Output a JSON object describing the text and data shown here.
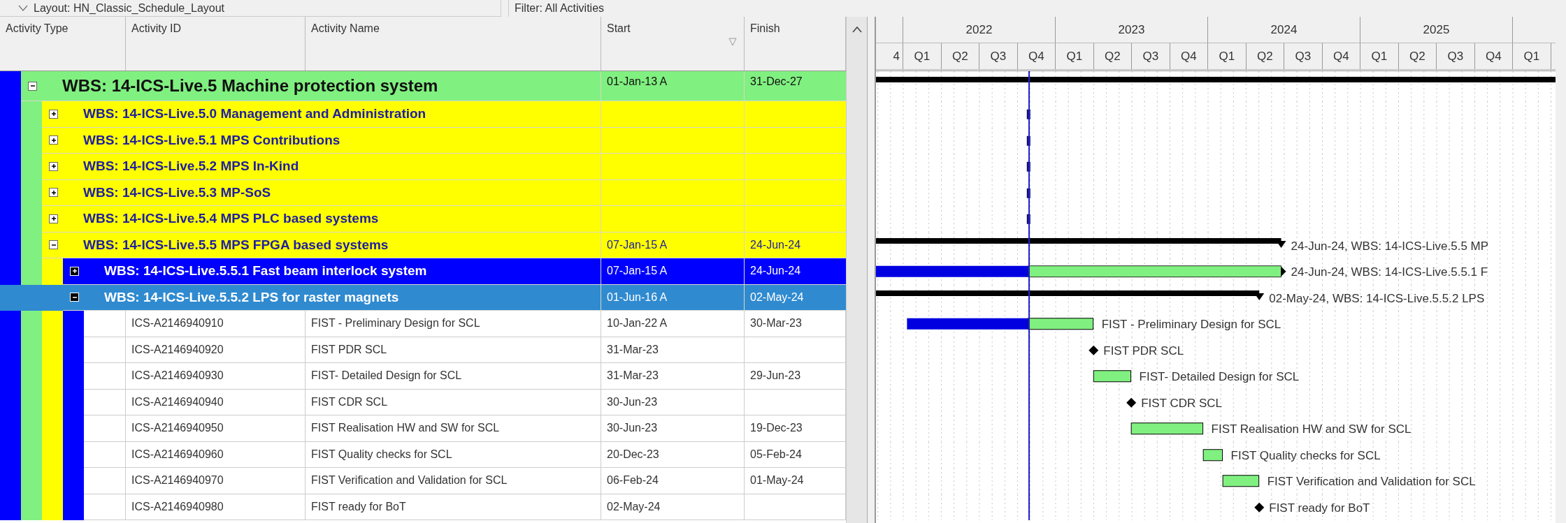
{
  "toolbar": {
    "layout": "Layout: HN_Classic_Schedule_Layout",
    "filter": "Filter: All Activities"
  },
  "columns": [
    {
      "label": "Activity Type",
      "sorted": false
    },
    {
      "label": "Activity ID",
      "sorted": false
    },
    {
      "label": "Activity Name",
      "sorted": false
    },
    {
      "label": "Start",
      "sorted": true
    },
    {
      "label": "Finish",
      "sorted": false
    }
  ],
  "gantt": {
    "years": [
      "2022",
      "2023",
      "2024",
      "2025"
    ],
    "quarters": [
      "4",
      "Q1",
      "Q2",
      "Q3",
      "Q4",
      "Q1",
      "Q2",
      "Q3",
      "Q4",
      "Q1",
      "Q2",
      "Q3",
      "Q4",
      "Q1",
      "Q2",
      "Q3",
      "Q4",
      "Q1"
    ]
  },
  "rows": [
    {
      "kind": "wbs",
      "title": "WBS: 14-ICS-Live.5  Machine protection system",
      "start": "01-Jan-13 A",
      "finish": "31-Dec-27",
      "expanded": true,
      "selected": false,
      "children": [
        {
          "kind": "wbs",
          "title": "WBS: 14-ICS-Live.5.0  Management and Administration",
          "expanded": false,
          "selected": false
        },
        {
          "kind": "wbs",
          "title": "WBS: 14-ICS-Live.5.1  MPS Contributions",
          "expanded": false,
          "selected": false
        },
        {
          "kind": "wbs",
          "title": "WBS: 14-ICS-Live.5.2  MPS In-Kind",
          "expanded": false,
          "selected": false
        },
        {
          "kind": "wbs",
          "title": "WBS: 14-ICS-Live.5.3  MP-SoS",
          "expanded": false,
          "selected": false
        },
        {
          "kind": "wbs",
          "title": "WBS: 14-ICS-Live.5.4  MPS PLC based systems",
          "expanded": false,
          "selected": false
        },
        {
          "kind": "wbs",
          "title": "WBS: 14-ICS-Live.5.5  MPS FPGA based systems",
          "start": "07-Jan-15 A",
          "finish": "24-Jun-24",
          "expanded": true,
          "selected": false,
          "bar_label": "24-Jun-24, WBS: 14-ICS-Live.5.5  MP",
          "children": [
            {
              "kind": "wbs",
              "title": "WBS: 14-ICS-Live.5.5.1  Fast beam interlock system",
              "start": "07-Jan-15 A",
              "finish": "24-Jun-24",
              "expanded": false,
              "selected": false,
              "bar_label": "24-Jun-24, WBS: 14-ICS-Live.5.5.1  F"
            },
            {
              "kind": "wbs",
              "title": "WBS: 14-ICS-Live.5.5.2  LPS for raster magnets",
              "start": "01-Jun-16 A",
              "finish": "02-May-24",
              "expanded": true,
              "selected": true,
              "bar_label": "02-May-24, WBS: 14-ICS-Live.5.5.2  LPS",
              "children": [
                {
                  "kind": "task",
                  "id": "ICS-A2146940910",
                  "name": "FIST - Preliminary Design for SCL",
                  "start": "10-Jan-22 A",
                  "finish": "30-Mar-23",
                  "selected": false,
                  "bar_label": "FIST - Preliminary Design for SCL"
                },
                {
                  "kind": "milestone",
                  "id": "ICS-A2146940920",
                  "name": "FIST PDR SCL",
                  "start": "31-Mar-23",
                  "selected": false,
                  "bar_label": "FIST PDR SCL"
                },
                {
                  "kind": "task",
                  "id": "ICS-A2146940930",
                  "name": "FIST- Detailed  Design for SCL",
                  "start": "31-Mar-23",
                  "finish": "29-Jun-23",
                  "selected": false,
                  "bar_label": "FIST- Detailed  Design for SCL"
                },
                {
                  "kind": "milestone",
                  "id": "ICS-A2146940940",
                  "name": "FIST CDR SCL",
                  "start": "30-Jun-23",
                  "selected": false,
                  "bar_label": "FIST CDR SCL"
                },
                {
                  "kind": "task",
                  "id": "ICS-A2146940950",
                  "name": "FIST Realisation HW and SW for SCL",
                  "start": "30-Jun-23",
                  "finish": "19-Dec-23",
                  "selected": false,
                  "bar_label": "FIST Realisation HW and SW for SCL"
                },
                {
                  "kind": "task",
                  "id": "ICS-A2146940960",
                  "name": "FIST Quality checks for SCL",
                  "start": "20-Dec-23",
                  "finish": "05-Feb-24",
                  "selected": false,
                  "bar_label": "FIST Quality checks for SCL"
                },
                {
                  "kind": "task",
                  "id": "ICS-A2146940970",
                  "name": "FIST Verification and Validation for SCL",
                  "start": "06-Feb-24",
                  "finish": "01-May-24",
                  "selected": false,
                  "bar_label": "FIST Verification and Validation for SCL"
                },
                {
                  "kind": "milestone",
                  "id": "ICS-A2146940980",
                  "name": "FIST ready for BoT",
                  "start": "02-May-24",
                  "selected": false,
                  "bar_label": "FIST ready for BoT"
                }
              ]
            }
          ]
        }
      ]
    }
  ]
}
